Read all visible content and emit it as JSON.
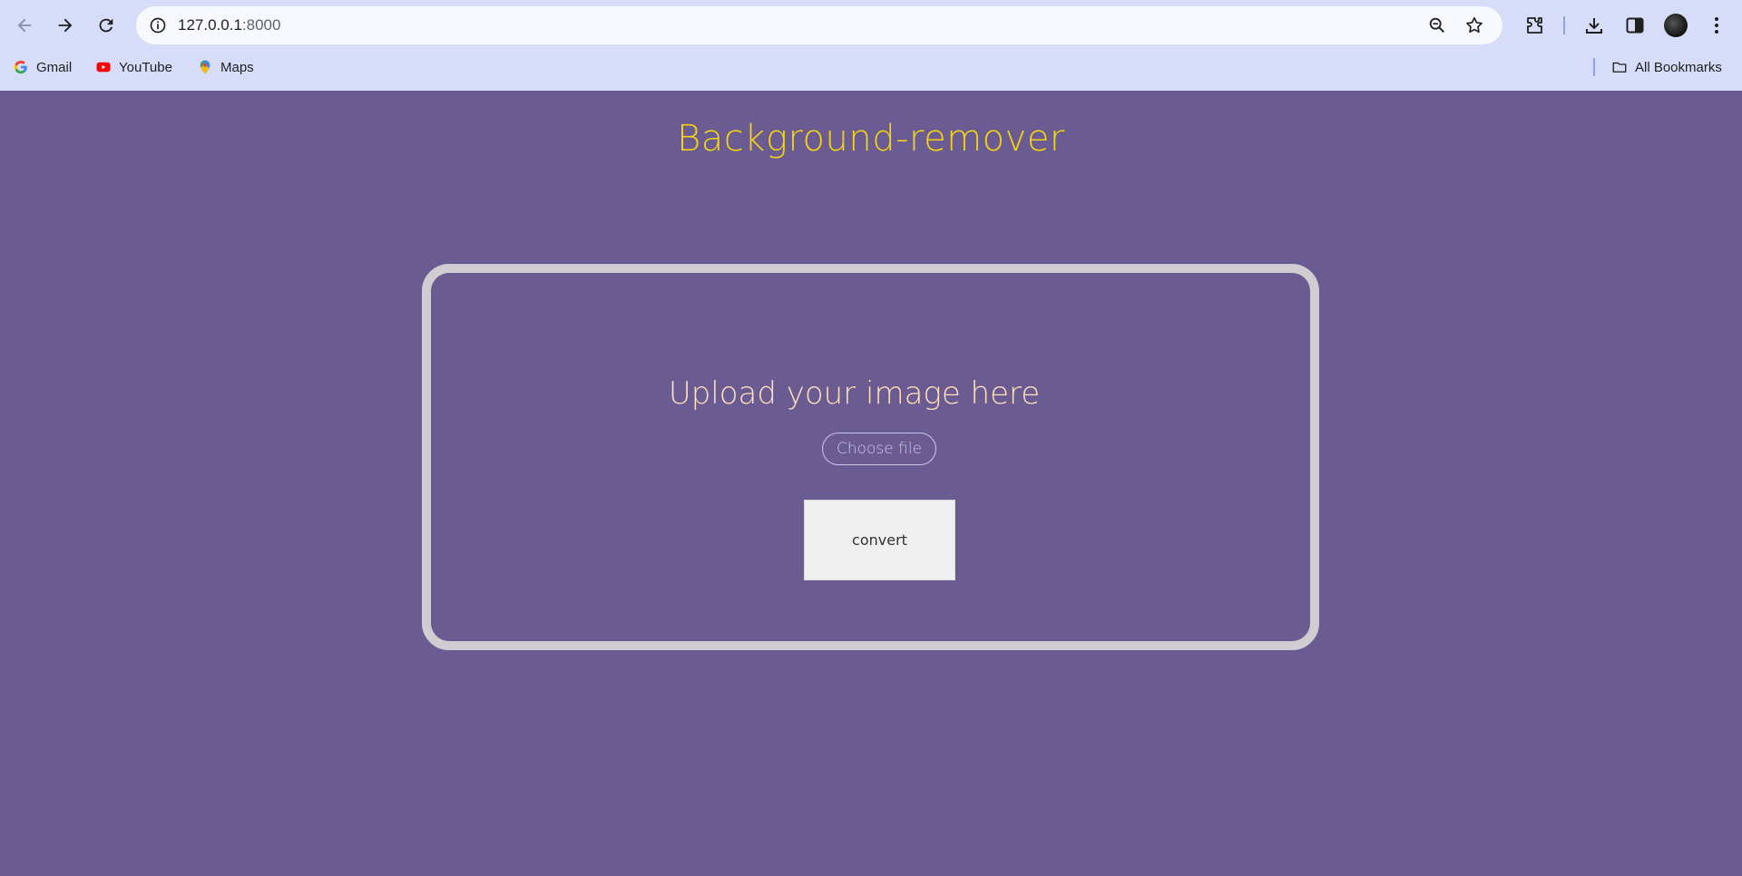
{
  "browser": {
    "url_host": "127.0.0.1",
    "url_port": ":8000",
    "bookmarks": [
      {
        "label": "Gmail",
        "icon": "google-icon"
      },
      {
        "label": "YouTube",
        "icon": "youtube-icon"
      },
      {
        "label": "Maps",
        "icon": "maps-icon"
      }
    ],
    "all_bookmarks_label": "All Bookmarks"
  },
  "page": {
    "title": "Background-remover",
    "upload_heading": "Upload your image here",
    "choose_file_label": "Choose file",
    "convert_label": "convert"
  },
  "colors": {
    "page_background": "#6a5b93",
    "title": "#f5d40f",
    "heading": "#ffe0b8",
    "card_border": "#cfcdd2"
  }
}
